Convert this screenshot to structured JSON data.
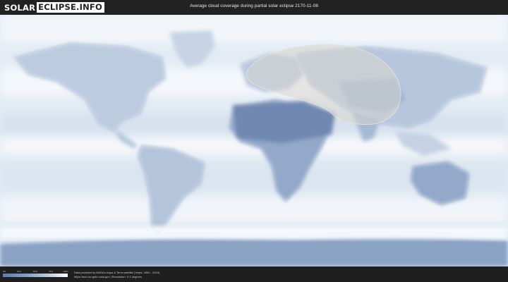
{
  "header": {
    "logo_part1": "SOLAR",
    "logo_part2": "ECLIPSE.INFO",
    "title": "Average cloud coverage during partial solar eclipse 2170-11-08"
  },
  "legend": {
    "ticks": [
      "0%",
      "25%",
      "50%",
      "75%",
      "100%"
    ],
    "colors": [
      "#5f7da8",
      "#8aa3c4",
      "#c7d4e5",
      "#ffffff"
    ]
  },
  "footer": {
    "credit_line1": "Data provided by NASA's Aqua & Terra satellite (Years: 2000 - 2019)",
    "credit_line2": "https://neo.sci.gsfc.nasa.gov | Resolution: 0.1 degrees"
  },
  "map": {
    "type": "world cloud coverage map",
    "eclipse_zone_color": "#d8d6cd"
  }
}
